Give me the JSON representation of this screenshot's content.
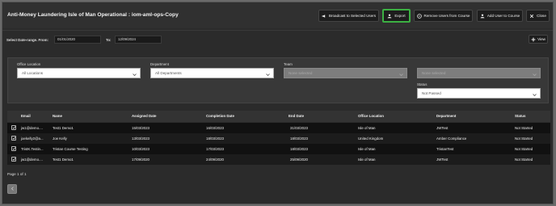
{
  "header": {
    "title": "Anti-Money Laundering Isle of Man Operational : iom-aml-ops-Copy",
    "buttons": {
      "broadcast": "Broadcast to Selected Users",
      "export": "Export",
      "remove": "Remove Users from Course",
      "add": "Add User to Course",
      "close": "Close"
    }
  },
  "dates": {
    "from_label": "Select Date-range. From:",
    "from_value": "01/01/2020",
    "to_label": "To:",
    "to_value": "12/09/2024",
    "view_label": "View"
  },
  "filters": {
    "office_label": "Office Location",
    "office_value": "All Locations",
    "department_label": "Department",
    "department_value": "All Departments",
    "team_label": "Team",
    "team_value": "None selected",
    "extra_value": "None selected",
    "status_label": "Status",
    "status_value": "Not Passed"
  },
  "table": {
    "columns": [
      "Email",
      "Name",
      "Assigned Date",
      "Completion Date",
      "End Date",
      "Office Location",
      "Department",
      "Status"
    ],
    "rows": [
      [
        "jw1@demo....",
        "Test1 Demo1",
        "15/03/2023",
        "16/03/2023",
        "31/03/2023",
        "Isle of Man",
        "JWTest",
        "Not Started"
      ],
      [
        "joekelly2@a...",
        "Joe Kelly",
        "13/03/2023",
        "18/03/2023",
        "18/03/2023",
        "United Kingdom",
        "Amber Compliance",
        "Not Started"
      ],
      [
        "TristK.Testin...",
        "Tristan Course Testing",
        "10/03/2023",
        "17/03/2023",
        "18/03/2023",
        "Isle of Man",
        "TristanTest",
        "Not Started"
      ],
      [
        "jw1@demo....",
        "Test1 Demo1",
        "17/09/2020",
        "24/09/2020",
        "25/09/2020",
        "Isle of Man",
        "JWTest",
        "Not Started"
      ]
    ]
  },
  "pagination": {
    "text": "Page 1 of 1"
  }
}
